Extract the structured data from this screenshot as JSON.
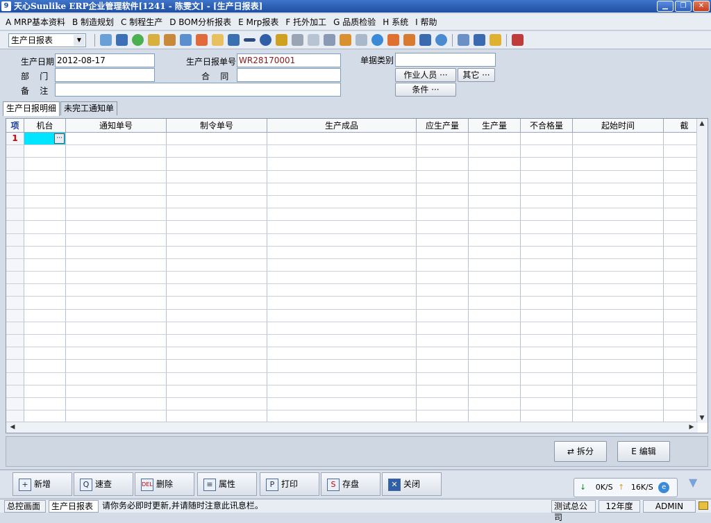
{
  "window": {
    "title": "天心Sunlike ERP企业管理软件[1241 - 陈雯文] - [生产日报表]"
  },
  "menu": [
    {
      "label": "A MRP基本资料"
    },
    {
      "label": "B 制造规划"
    },
    {
      "label": "C 制程生产"
    },
    {
      "label": "D BOM分析报表"
    },
    {
      "label": "E Mrp报表"
    },
    {
      "label": "F 托外加工"
    },
    {
      "label": "G 品质检验"
    },
    {
      "label": "H 系统"
    },
    {
      "label": "I 帮助"
    }
  ],
  "toolbar": {
    "report_select": "生产日报表"
  },
  "form": {
    "date_label": "生产日期",
    "date_value": "2012-08-17",
    "report_no_label": "生产日报单号",
    "report_no_value": "WR28170001",
    "doc_type_label": "单据类别",
    "doc_type_value": "",
    "dept_label": "部    门",
    "dept_value": "",
    "contract_label": "合    同",
    "contract_value": "",
    "remark_label": "备    注",
    "remark_value": "",
    "operators_btn": "作业人员 ···",
    "other_btn": "其它 ···",
    "condition_btn": "条件 ···"
  },
  "tabs": [
    {
      "label": "生产日报明细"
    },
    {
      "label": "未完工通知单"
    }
  ],
  "grid": {
    "columns": [
      "项",
      "机台",
      "通知单号",
      "制令单号",
      "生产成品",
      "应生产量",
      "生产量",
      "不合格量",
      "起始时间",
      "截"
    ],
    "first_row_index": "1",
    "ellipsis": "···"
  },
  "actions": {
    "split": "拆分",
    "edit": "E 编辑"
  },
  "bottom_buttons": [
    {
      "label": "新增",
      "icon": "+"
    },
    {
      "label": "速查",
      "icon": "Q"
    },
    {
      "label": "删除",
      "icon": "DEL"
    },
    {
      "label": "属性",
      "icon": "≡"
    },
    {
      "label": "打印",
      "icon": "P"
    },
    {
      "label": "存盘",
      "icon": "S"
    },
    {
      "label": "关闭",
      "icon": "✕"
    }
  ],
  "network": {
    "down": "0K/S",
    "up": "16K/S"
  },
  "status": {
    "tab1": "总控画面",
    "tab2": "生产日报表",
    "message": "请你务必即时更新,并请随时注意此讯息栏。",
    "company": "测试总公司",
    "year": "12年度",
    "user": "ADMIN"
  }
}
